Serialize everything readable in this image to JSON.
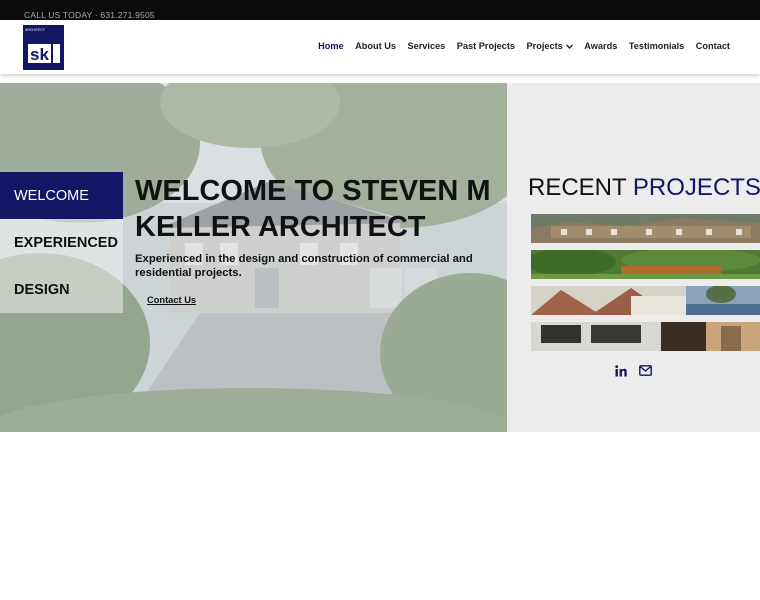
{
  "topbar": {
    "call_text": "CALL US TODAY · 631.271.9505"
  },
  "logo": {
    "alt": "SK Architect logo",
    "small_text": "ARCHITECT",
    "initials": "SK"
  },
  "nav": {
    "items": [
      {
        "label": "Home",
        "active": true
      },
      {
        "label": "About Us"
      },
      {
        "label": "Services"
      },
      {
        "label": "Past Projects"
      },
      {
        "label": "Projects",
        "has_dropdown": true
      },
      {
        "label": "Awards"
      },
      {
        "label": "Testimonials"
      },
      {
        "label": "Contact"
      }
    ]
  },
  "hero": {
    "tabs": [
      {
        "label": "WELCOME",
        "active": true
      },
      {
        "label": "EXPERIENCED"
      },
      {
        "label": "DESIGN"
      }
    ],
    "title": "WELCOME TO STEVEN M KELLER ARCHITECT",
    "subtitle": "Experienced in the design and construction of commercial and residential projects.",
    "link": "Contact Us"
  },
  "recent": {
    "title_plain": "RECENT",
    "title_accent": "PROJECTS",
    "thumbnails": [
      "project-house-exterior",
      "project-garden",
      "project-roofline-lake",
      "project-interior"
    ]
  },
  "socials": {
    "icons": [
      "linkedin-icon",
      "email-icon"
    ]
  },
  "colors": {
    "brand": "#121665",
    "topbar": "#0b0b0b",
    "panel": "#ececec"
  }
}
